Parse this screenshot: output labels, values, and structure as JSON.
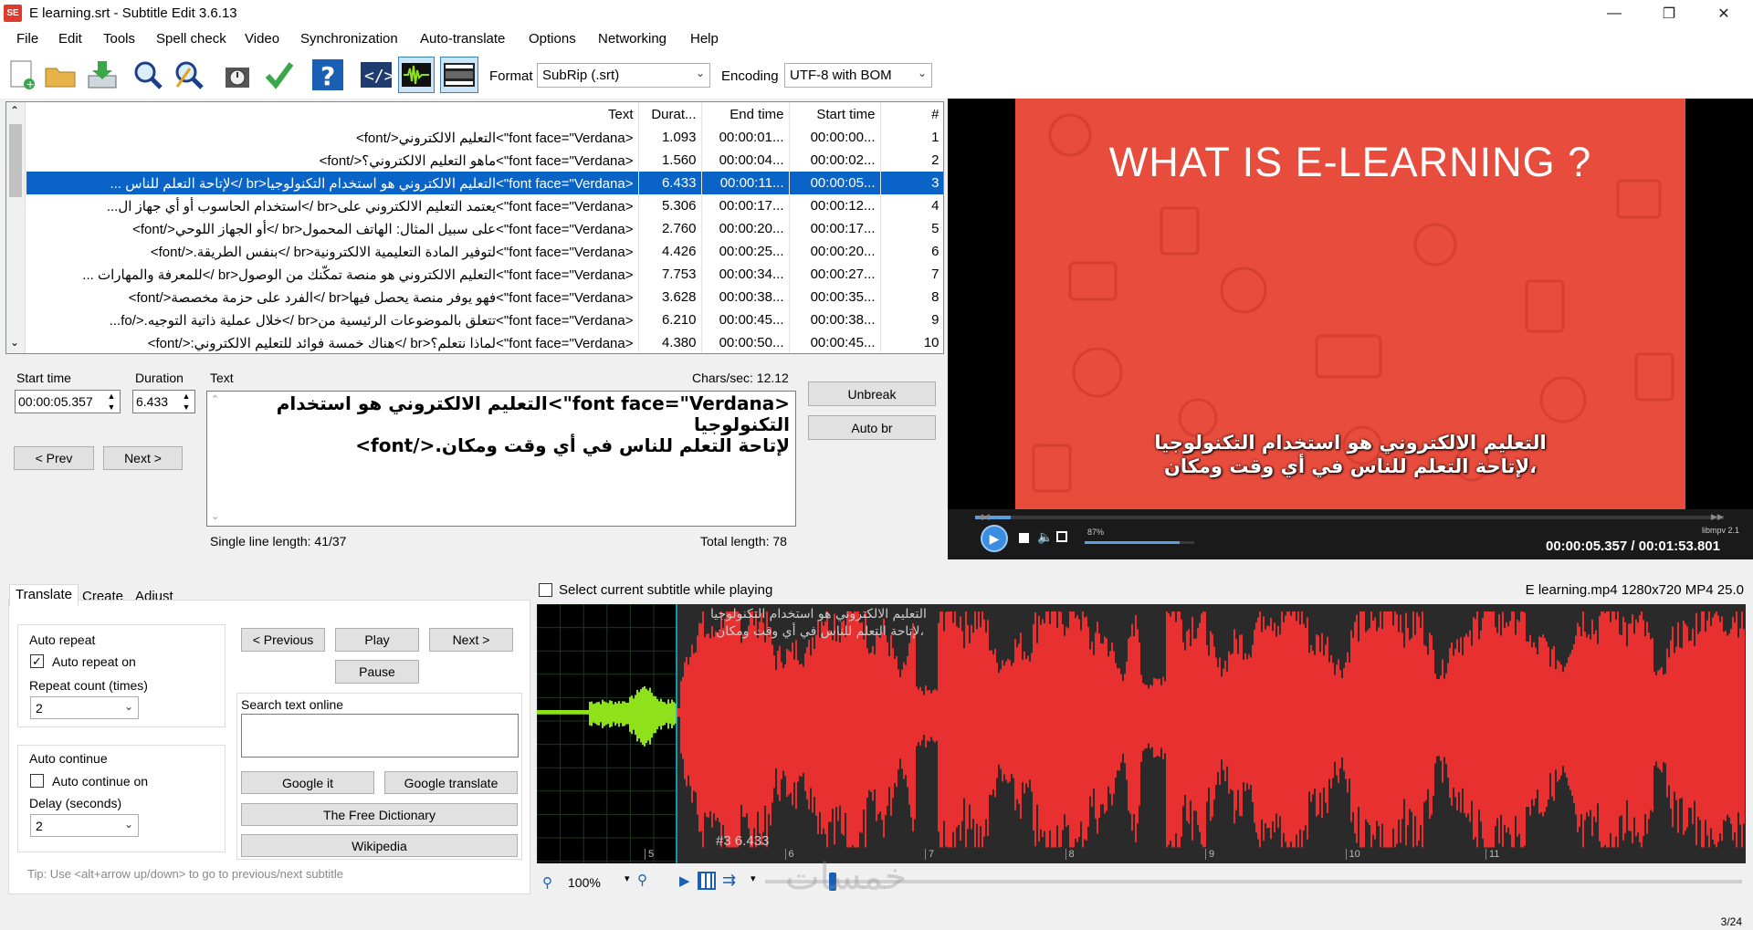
{
  "window": {
    "title": "E learning.srt - Subtitle Edit 3.6.13",
    "icon": "SE"
  },
  "menu": [
    "File",
    "Edit",
    "Tools",
    "Spell check",
    "Video",
    "Synchronization",
    "Auto-translate",
    "Options",
    "Networking",
    "Help"
  ],
  "toolbar": {
    "format_label": "Format",
    "format_value": "SubRip (.srt)",
    "encoding_label": "Encoding",
    "encoding_value": "UTF-8 with BOM",
    "icons": [
      "new-file-icon",
      "open-folder-icon",
      "download-icon",
      "find-icon",
      "replace-icon",
      "visual-sync-icon",
      "spell-check-icon",
      "help-icon",
      "source-view-icon",
      "waveform-toggle-icon",
      "video-toggle-icon"
    ]
  },
  "grid": {
    "headers": {
      "num": "#",
      "start": "Start time",
      "end": "End time",
      "dur": "Durat...",
      "text": "Text"
    },
    "selected_index": 2,
    "rows": [
      {
        "num": "1",
        "start": "00:00:00...",
        "end": "00:00:01...",
        "dur": "1.093",
        "text": "<font face=\"Verdana\">التعليم الالكتروني</font>"
      },
      {
        "num": "2",
        "start": "00:00:02...",
        "end": "00:00:04...",
        "dur": "1.560",
        "text": "<font face=\"Verdana\">ماهو التعليم الالكتروني؟</font>"
      },
      {
        "num": "3",
        "start": "00:00:05...",
        "end": "00:00:11...",
        "dur": "6.433",
        "text": "<font face=\"Verdana\">التعليم الالكتروني هو استخدام التكنولوجيا<br />لإتاحة التعلم للناس ..."
      },
      {
        "num": "4",
        "start": "00:00:12...",
        "end": "00:00:17...",
        "dur": "5.306",
        "text": "<font face=\"Verdana\">يعتمد التعليم الالكتروني على<br />استخدام الحاسوب أو أي جهاز ال..."
      },
      {
        "num": "5",
        "start": "00:00:17...",
        "end": "00:00:20...",
        "dur": "2.760",
        "text": "<font face=\"Verdana\">على سبيل المثال: الهاتف المحمول<br />أو الجهاز اللوحي</font>"
      },
      {
        "num": "6",
        "start": "00:00:20...",
        "end": "00:00:25...",
        "dur": "4.426",
        "text": "<font face=\"Verdana\">لتوفير المادة التعليمية الالكترونية<br />بنفس الطريقة.</font>"
      },
      {
        "num": "7",
        "start": "00:00:27...",
        "end": "00:00:34...",
        "dur": "7.753",
        "text": "<font face=\"Verdana\">التعليم الالكتروني هو منصة تمكّنك من الوصول<br />للمعرفة والمهارات ..."
      },
      {
        "num": "8",
        "start": "00:00:35...",
        "end": "00:00:38...",
        "dur": "3.628",
        "text": "<font face=\"Verdana\">فهو يوفر منصة يحصل فيها<br />الفرد على حزمة مخصصة</font>"
      },
      {
        "num": "9",
        "start": "00:00:38...",
        "end": "00:00:45...",
        "dur": "6.210",
        "text": "<font face=\"Verdana\">تتعلق بالموضوعات الرئيسية من<br />خلال عملية ذاتية التوجيه.</fo..."
      },
      {
        "num": "10",
        "start": "00:00:45...",
        "end": "00:00:50...",
        "dur": "4.380",
        "text": "<font face=\"Verdana\">لماذا نتعلم؟<br />هناك خمسة فوائد للتعليم الالكتروني:</font>"
      }
    ]
  },
  "editor": {
    "start_time_label": "Start time",
    "start_time_value": "00:00:05.357",
    "duration_label": "Duration",
    "duration_value": "6.433",
    "text_label": "Text",
    "chars_sec": "Chars/sec: 12.12",
    "prev_label": "< Prev",
    "next_label": "Next >",
    "unbreak_label": "Unbreak",
    "autobr_label": "Auto br",
    "text_lines": [
      "<font face=\"Verdana\">التعليم الالكتروني هو استخدام",
      "التكنولوجيا",
      "لإتاحة التعلم للناس  في أي وقت ومكان.</font>"
    ],
    "single_line_length": "Single line length: 41/37",
    "total_length": "Total length: 78"
  },
  "video": {
    "title": "WHAT IS E-LEARNING ?",
    "subtitle_line1": "التعليم الالكتروني هو استخدام التكنولوجيا",
    "subtitle_line2": "لإتاحة التعلم للناس  في أي وقت ومكان،",
    "volume": "87%",
    "engine": "libmpv 2.1",
    "time": "00:00:05.357 / 00:01:53.801",
    "progress": 0.047,
    "volume_fraction": 0.87
  },
  "tabs": {
    "items": [
      "Translate",
      "Create",
      "Adjust"
    ],
    "auto_repeat_title": "Auto repeat",
    "auto_repeat_on": "Auto repeat on",
    "repeat_count_label": "Repeat count (times)",
    "repeat_count_value": "2",
    "auto_continue_title": "Auto continue",
    "auto_continue_on": "Auto continue on",
    "delay_label": "Delay (seconds)",
    "delay_value": "2",
    "previous_label": "< Previous",
    "play_label": "Play",
    "next_label": "Next >",
    "pause_label": "Pause",
    "search_online_label": "Search text online",
    "google_it": "Google it",
    "google_translate": "Google translate",
    "free_dictionary": "The Free Dictionary",
    "wikipedia": "Wikipedia",
    "tip": "Tip: Use <alt+arrow up/down> to go to previous/next subtitle"
  },
  "waveform": {
    "select_current": "Select current subtitle while playing",
    "file_info": "E learning.mp4 1280x720 MP4 25.0",
    "sub_line1": "التعليم الالكتروني هو استخدام التكنولوجيا",
    "sub_line2": "لإتاحة التعلم للناس  في أي وقت ومكان،",
    "marker": "#3  6.433",
    "seconds": [
      "5",
      "6",
      "7",
      "8",
      "9",
      "10",
      "11"
    ],
    "zoom": "100%",
    "colors": {
      "selected": "#e83030",
      "unselected": "#8fe21a",
      "background": "#000000"
    }
  },
  "statusbar": {
    "position": "3/24"
  },
  "watermark": "خمسات"
}
